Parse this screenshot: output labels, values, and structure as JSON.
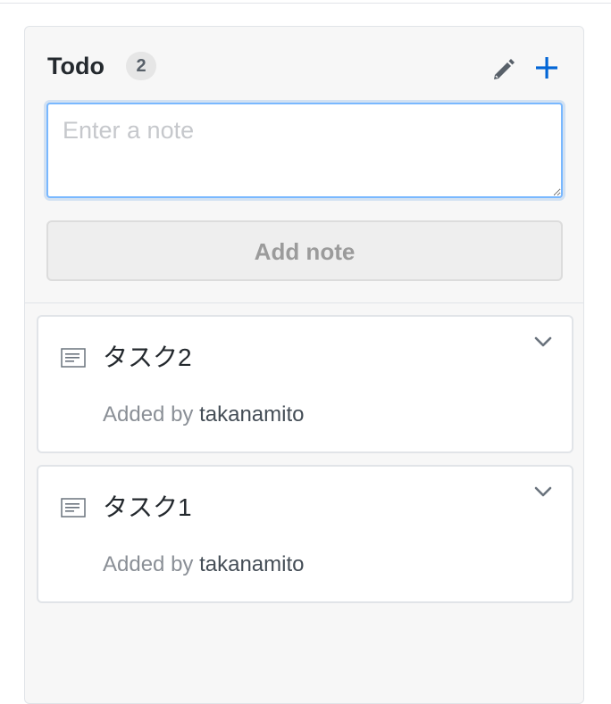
{
  "column": {
    "title": "Todo",
    "count": "2"
  },
  "note_form": {
    "placeholder": "Enter a note",
    "add_button": "Add note"
  },
  "cards": [
    {
      "title": "タスク2",
      "added_by_label": "Added by",
      "author": "takanamito"
    },
    {
      "title": "タスク1",
      "added_by_label": "Added by",
      "author": "takanamito"
    }
  ],
  "icons": {
    "header_edit": "pencil-icon",
    "header_add": "plus-icon",
    "card_type": "note-icon",
    "card_menu": "chevron-down-icon"
  },
  "colors": {
    "accent": "#0366d6",
    "focus_border": "#79b8ff",
    "column_bg": "#f7f7f7"
  }
}
